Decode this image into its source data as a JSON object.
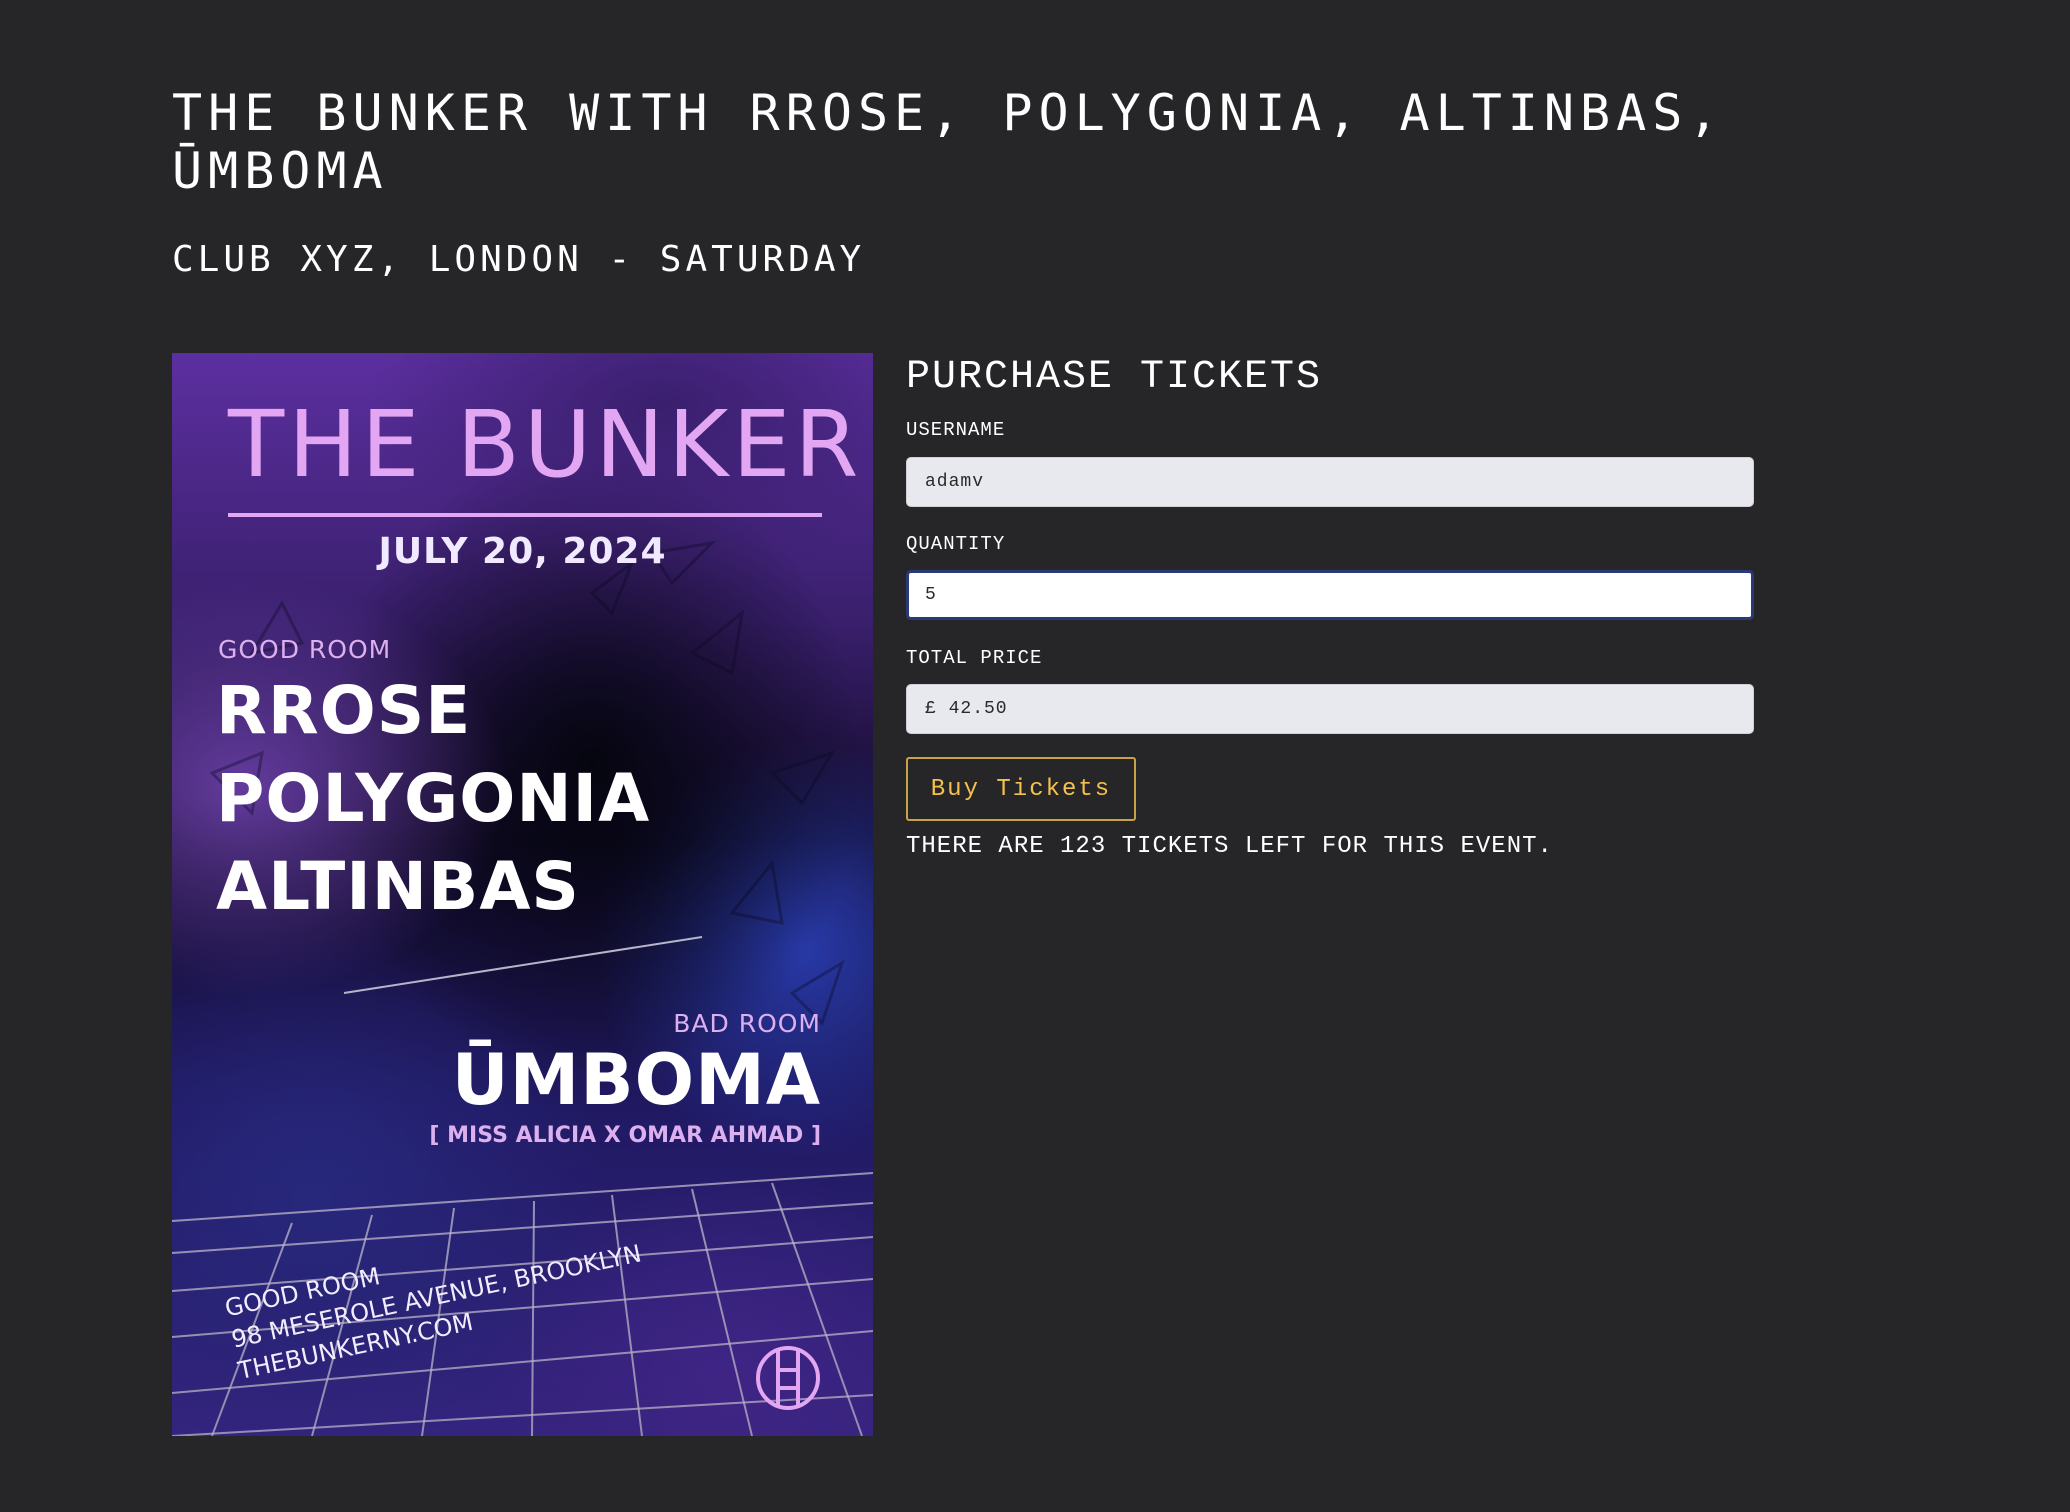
{
  "event": {
    "title": "The Bunker with Rrose, Polygonia, Altinbas, Ūmboma",
    "subtitle": "Club XYZ, London - Saturday"
  },
  "poster": {
    "venue_title": "THE BUNKER",
    "date": "JULY 20, 2024",
    "good_room_label": "GOOD ROOM",
    "good_room_artists": [
      "RROSE",
      "POLYGONIA",
      "ALTINBAS"
    ],
    "bad_room_label": "BAD ROOM",
    "bad_room_artist": "ŪMBOMA",
    "bad_room_crew": "[ MISS ALICIA X OMAR AHMAD ]",
    "address_lines": [
      "GOOD ROOM",
      "98 MESEROLE AVENUE, BROOKLYN",
      "THEBUNKERNY.COM"
    ],
    "logo_icon": "bunker-logo-icon",
    "accent_color": "#e2a6f2"
  },
  "purchase": {
    "heading": "PURCHASE TICKETS",
    "username_label": "USERNAME",
    "username_value": "adamv",
    "quantity_label": "QUANTITY",
    "quantity_value": "5",
    "total_label": "TOTAL PRICE",
    "total_value": "£ 42.50",
    "buy_label": "Buy Tickets",
    "tickets_left_text": "There are 123 tickets left for this event."
  },
  "colors": {
    "background": "#262628",
    "button_accent": "#f4c14a",
    "focus_border": "#2a3a78"
  }
}
